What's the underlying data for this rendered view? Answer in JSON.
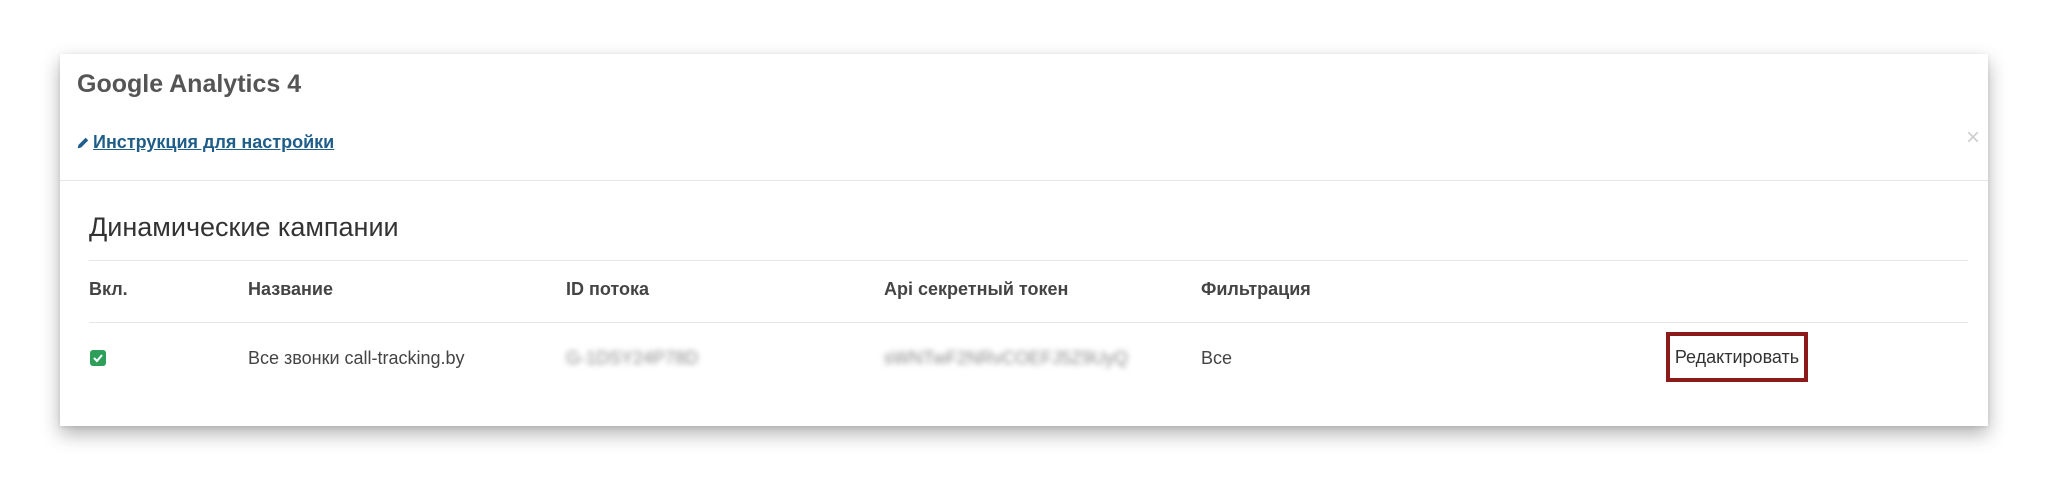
{
  "card": {
    "title": "Google Analytics 4",
    "guide_link": "Инструкция для настройки",
    "close_symbol": "×"
  },
  "section": {
    "title": "Динамические кампании"
  },
  "table": {
    "headers": [
      "Вкл.",
      "Название",
      "ID потока",
      "Api секретный токен",
      "Фильтрация"
    ],
    "rows": [
      {
        "enabled": true,
        "name": "Все звонки call-tracking.by",
        "stream_id": "G-1DSY24P78D",
        "api_token": "sWNTwF2NRvCOEFJ5Z9UyQ",
        "filter": "Все",
        "edit_label": "Редактировать"
      }
    ]
  },
  "colors": {
    "checkbox_green": "#2e9e5b",
    "link_blue": "#1f5e89",
    "highlight_border": "#8b1b1b"
  },
  "icons": {
    "guide_link_icon": "pencil-icon",
    "close_icon": "close-icon",
    "checkbox_icon": "check-icon"
  }
}
